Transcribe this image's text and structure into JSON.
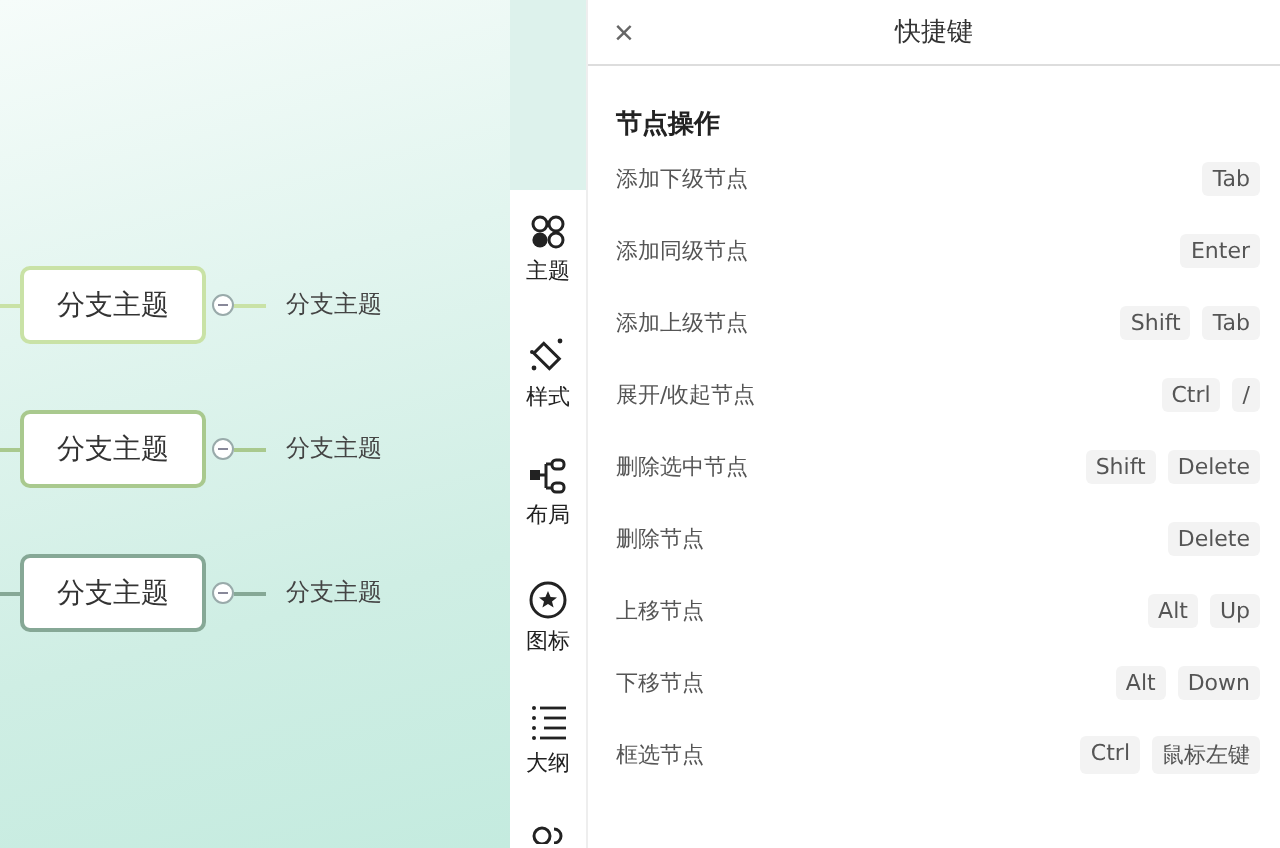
{
  "canvas": {
    "branches": [
      {
        "label": "分支主题",
        "color": "#c9e2a6",
        "child": "分支主题"
      },
      {
        "label": "分支主题",
        "color": "#a9c98e",
        "child": "分支主题"
      },
      {
        "label": "分支主题",
        "color": "#86a896",
        "child": "分支主题"
      }
    ]
  },
  "toolbar": {
    "items": [
      {
        "kind": "theme",
        "label": "主题"
      },
      {
        "kind": "style",
        "label": "样式"
      },
      {
        "kind": "layout",
        "label": "布局"
      },
      {
        "kind": "icon",
        "label": "图标"
      },
      {
        "kind": "outline",
        "label": "大纲"
      },
      {
        "kind": "more"
      }
    ]
  },
  "panel": {
    "close": "×",
    "title": "快捷键",
    "section": "节点操作",
    "shortcuts": [
      {
        "action": "添加下级节点",
        "keys": [
          "Tab"
        ]
      },
      {
        "action": "添加同级节点",
        "keys": [
          "Enter"
        ]
      },
      {
        "action": "添加上级节点",
        "keys": [
          "Shift",
          "Tab"
        ]
      },
      {
        "action": "展开/收起节点",
        "keys": [
          "Ctrl",
          "/"
        ]
      },
      {
        "action": "删除选中节点",
        "keys": [
          "Shift",
          "Delete"
        ]
      },
      {
        "action": "删除节点",
        "keys": [
          "Delete"
        ]
      },
      {
        "action": "上移节点",
        "keys": [
          "Alt",
          "Up"
        ]
      },
      {
        "action": "下移节点",
        "keys": [
          "Alt",
          "Down"
        ]
      },
      {
        "action": "框选节点",
        "keys": [
          "Ctrl",
          "鼠标左键"
        ]
      }
    ]
  }
}
